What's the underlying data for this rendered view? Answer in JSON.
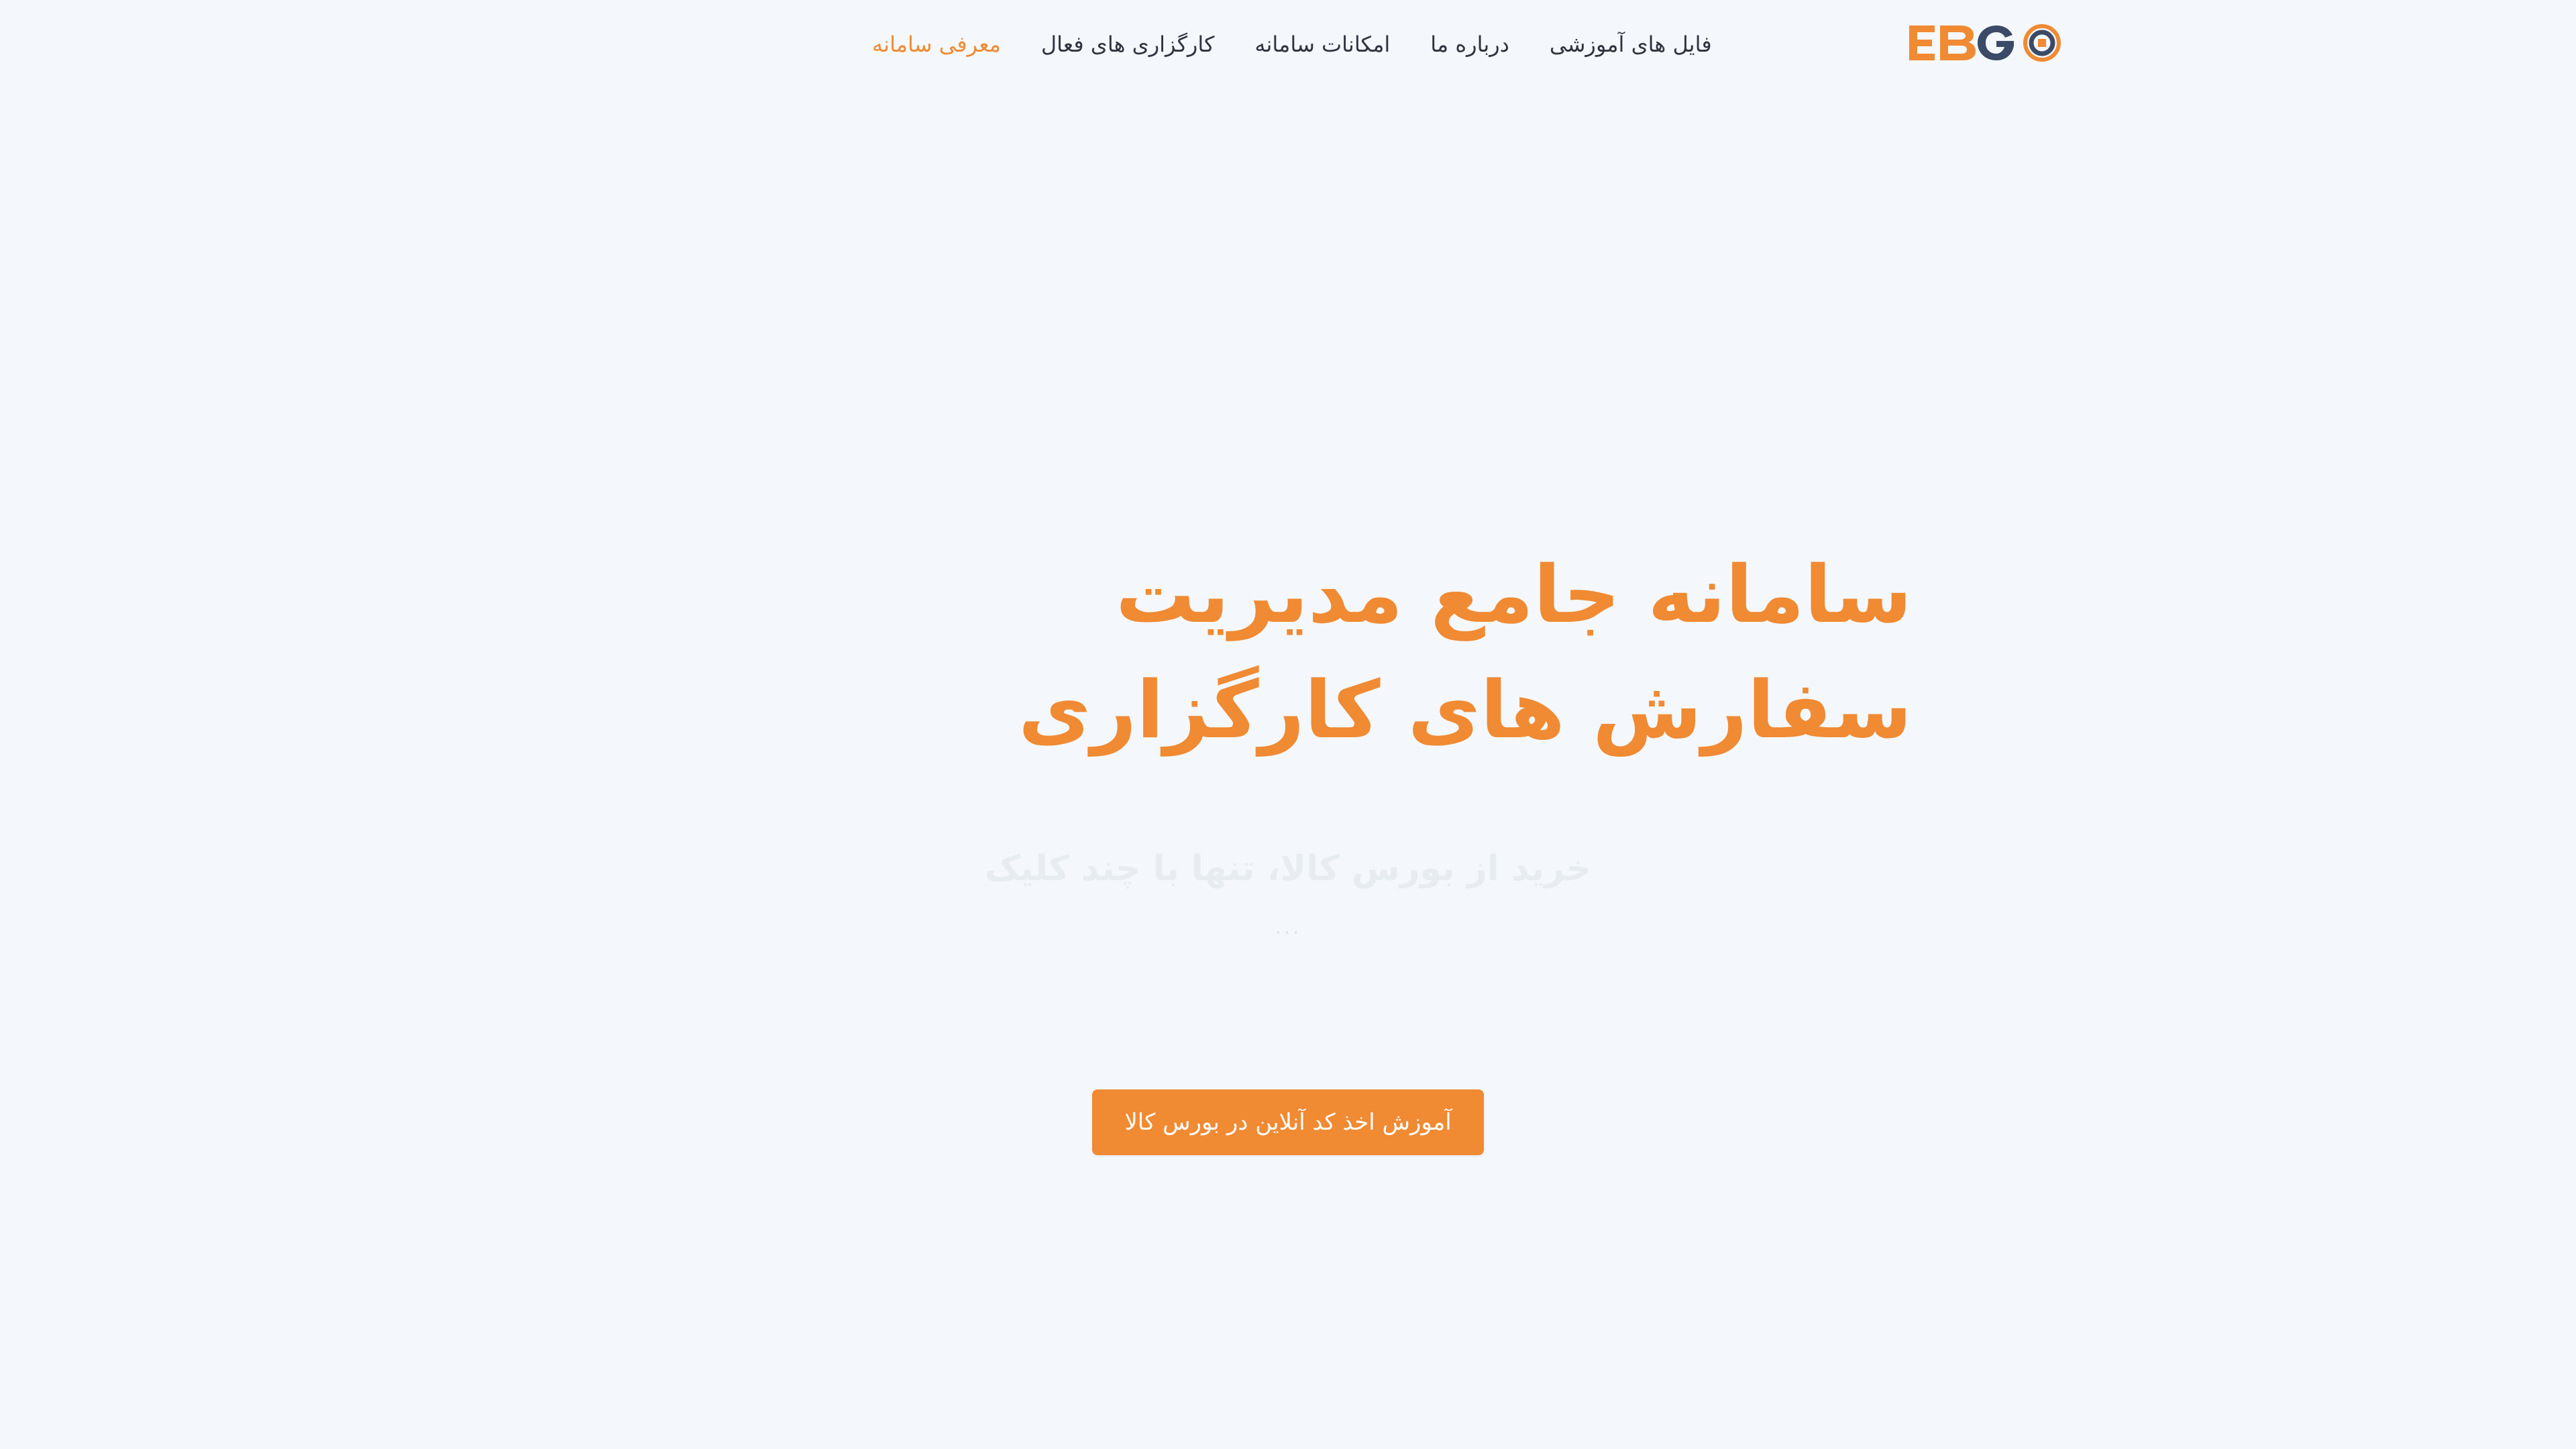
{
  "colors": {
    "accent": "#f08a33",
    "background": "#f4f8fc",
    "nav_text": "#2f3340",
    "logo_dark": "#3b4a66"
  },
  "logo": {
    "text": "EBGO"
  },
  "nav": {
    "items": [
      {
        "label": "معرفی سامانه",
        "active": true
      },
      {
        "label": "کارگزاری های فعال",
        "active": false
      },
      {
        "label": "امکانات سامانه",
        "active": false
      },
      {
        "label": "درباره ما",
        "active": false
      },
      {
        "label": "فایل های آموزشی",
        "active": false
      }
    ]
  },
  "hero": {
    "title": "سامانه جامع مدیریت سفارش های کارگزاری",
    "subtitle": "خرید از بورس کالا، تنها با چند کلیک",
    "dots": "...",
    "cta_label": "آموزش اخذ کد آنلاین در بورس کالا"
  }
}
